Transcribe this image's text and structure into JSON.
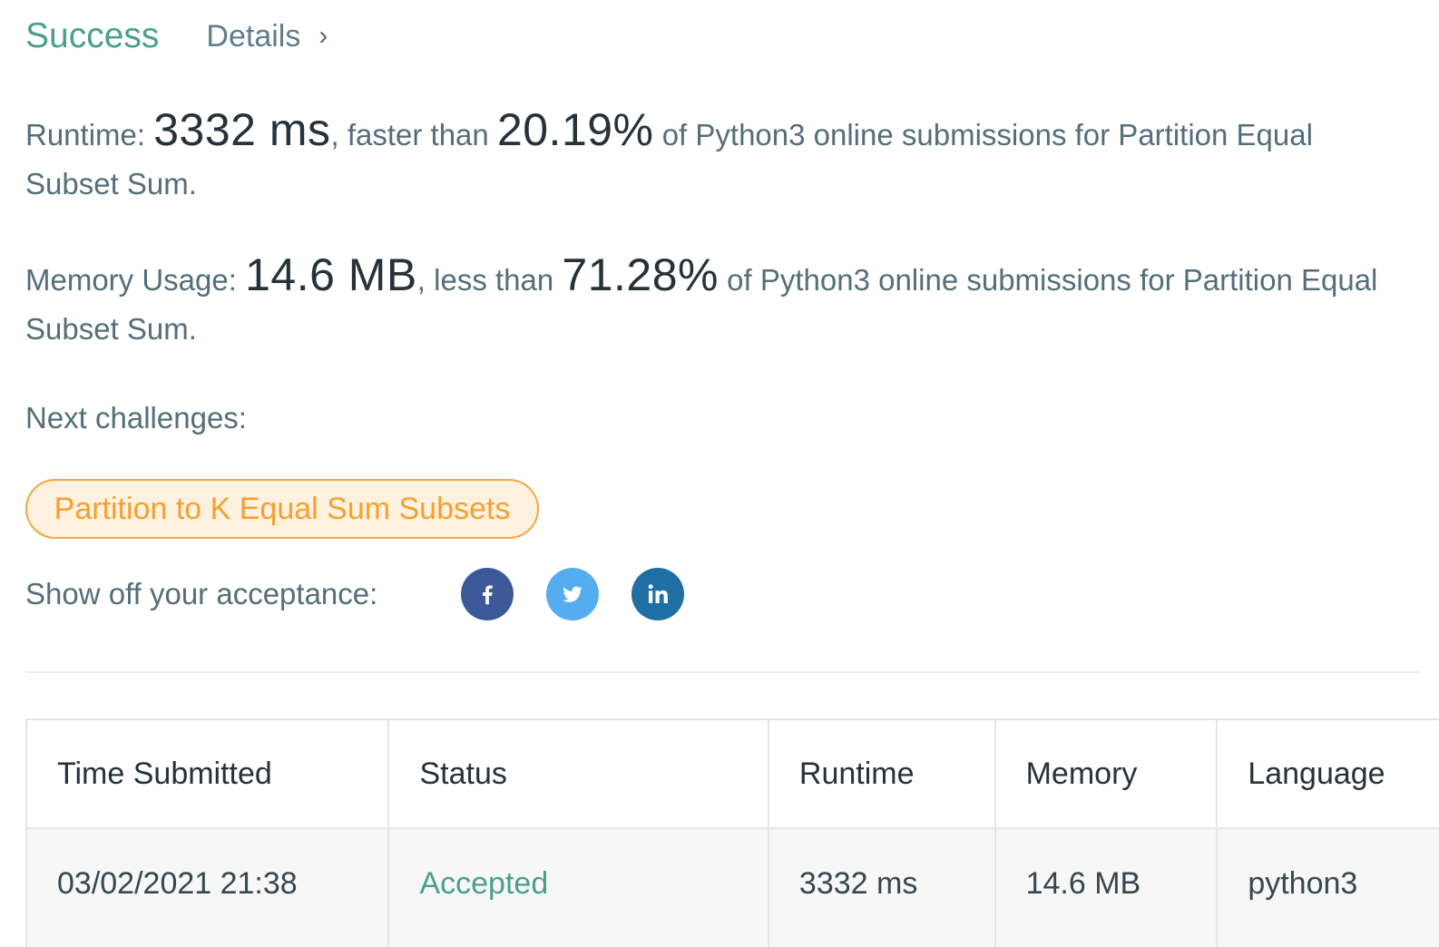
{
  "header": {
    "status": "Success",
    "details_label": "Details",
    "chevron": "›"
  },
  "runtime": {
    "label": "Runtime: ",
    "value": "3332 ms",
    "mid_text": ", faster than ",
    "percent": "20.19%",
    "suffix": " of Python3 online submissions for Partition Equal Subset Sum."
  },
  "memory": {
    "label": "Memory Usage: ",
    "value": "14.6 MB",
    "mid_text": ", less than ",
    "percent": "71.28%",
    "suffix": " of Python3 online submissions for Partition Equal Subset Sum."
  },
  "next_challenges": {
    "label": "Next challenges:",
    "items": [
      "Partition to K Equal Sum Subsets"
    ]
  },
  "share": {
    "label": "Show off your acceptance:",
    "icons": [
      "facebook-icon",
      "twitter-icon",
      "linkedin-icon"
    ],
    "colors": {
      "facebook": "#3b5998",
      "twitter": "#55acee",
      "linkedin": "#1f6fa5"
    }
  },
  "table": {
    "columns": [
      "Time Submitted",
      "Status",
      "Runtime",
      "Memory",
      "Language"
    ],
    "rows": [
      {
        "time": "03/02/2021 21:38",
        "status": "Accepted",
        "runtime": "3332 ms",
        "memory": "14.6 MB",
        "language": "python3"
      }
    ]
  },
  "colors": {
    "success": "#4aa08d",
    "challenge_text": "#f5a12d",
    "challenge_border": "#f3a93e",
    "challenge_bg": "#fef1e0"
  }
}
